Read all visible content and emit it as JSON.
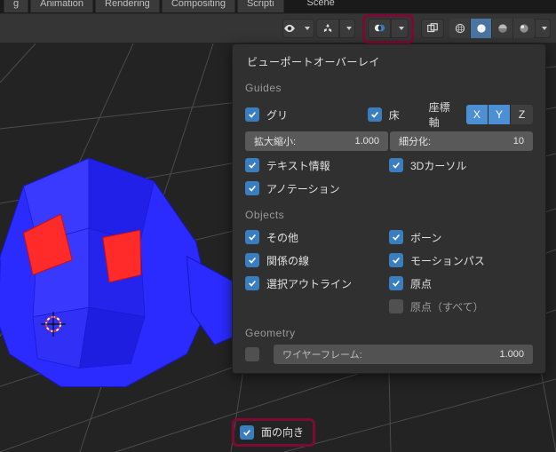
{
  "tabs": {
    "modeling": "g",
    "animation": "Animation",
    "rendering": "Rendering",
    "compositing": "Compositing",
    "scripting": "Scripti",
    "scene": "Scene"
  },
  "popover": {
    "title": "ビューポートオーバーレイ",
    "sections": {
      "guides_label": "Guides",
      "objects_label": "Objects",
      "geometry_label": "Geometry"
    },
    "guides": {
      "grid": "グリ",
      "floor": "床",
      "axes_label": "座標軸",
      "axes": {
        "x": "X",
        "y": "Y",
        "z": "Z"
      },
      "scale_label": "拡大縮小:",
      "scale_value": "1.000",
      "subdiv_label": "細分化:",
      "subdiv_value": "10",
      "text_info": "テキスト情報",
      "cursor3d": "3Dカーソル",
      "annotations": "アノテーション"
    },
    "objects": {
      "extras": "その他",
      "bones": "ボーン",
      "relationship_lines": "関係の線",
      "motion_paths": "モーションパス",
      "outline_selected": "選択アウトライン",
      "origins": "原点",
      "origins_all": "原点（すべて）"
    },
    "geometry": {
      "wireframe_label": "ワイヤーフレーム:",
      "wireframe_value": "1.000",
      "face_orientation": "面の向き"
    }
  }
}
